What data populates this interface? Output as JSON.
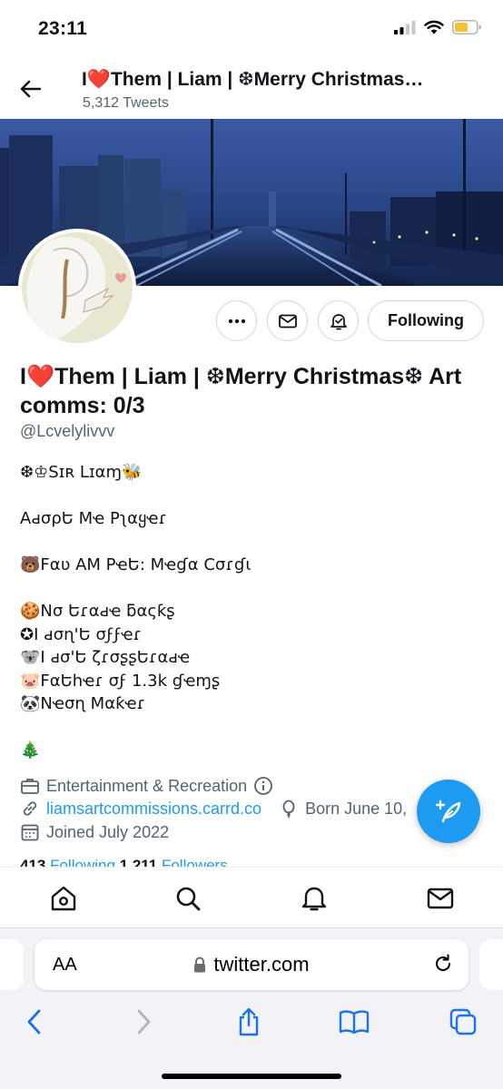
{
  "status_bar": {
    "time": "23:11"
  },
  "header": {
    "name": "I❤️Them | Liam | ❆Merry Christmas❆ Art comms: 0/3",
    "tweet_count": "5,312 Tweets"
  },
  "profile": {
    "display_name": "I❤️Them | Liam | ❆Merry Christmas❆ Art comms: 0/3",
    "handle": "@Lcvelylivvv",
    "following_label": "Following",
    "bio": "❆♔Sɪʀ Lɪαɱ🐝\n\nAԁσρԵ Mҽ Pʅαყҽɾ\n\n🐻Fαʋ AM PҽԵ: Mҽɠα Cσɾɠι\n\n🍪Nσ Եɾαԁҽ ƃαςƙʂ\n✪I ԁσɳ'Ե σϝϝҽɾ\n🐨I ԁσ'Ե ζɾσʂʂԵɾαԁҽ\n🐷FαԵհҽɾ σϝ 1.3k ɠҽɱʂ\n🐼Nҽσɳ Mαƙҽɾ\n\n🎄",
    "category": "Entertainment & Recreation",
    "website": "liamsartcommissions.carrd.co",
    "birthday": "Born June 10,",
    "joined": "Joined July 2022",
    "following_count": "413",
    "following_label_text": " Following   ",
    "followers_count": "1,211",
    "followers_label_text": " Followers"
  },
  "safari": {
    "aa": "AA",
    "domain": "twitter.com"
  },
  "colors": {
    "accent": "#1d9bf0",
    "secondary_text": "#536471",
    "border": "#cfd9de"
  }
}
